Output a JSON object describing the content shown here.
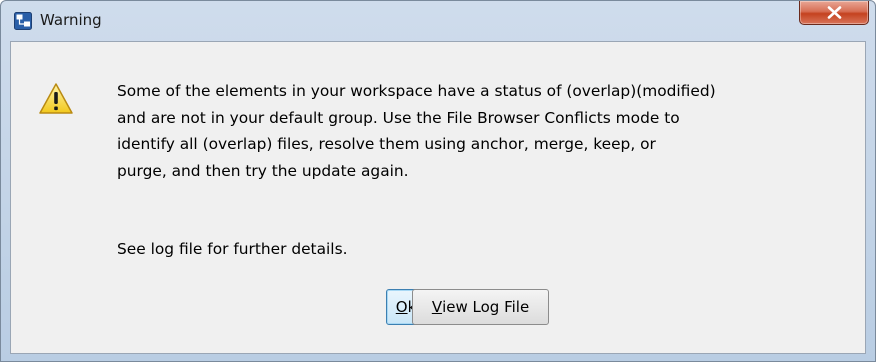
{
  "window": {
    "title": "Warning"
  },
  "message": {
    "lines": [
      "Some of the elements in your workspace have a status of (overlap)(modified)",
      "and are not in your default group. Use the File Browser Conflicts mode to",
      "identify all (overlap) files, resolve them using anchor, merge, keep, or",
      "purge, and then try the update again."
    ],
    "details": "See log file for further details."
  },
  "buttons": {
    "ok_mnemonic": "O",
    "ok_rest": "k",
    "viewlog_mnemonic": "V",
    "viewlog_rest": "iew Log File"
  },
  "icons": {
    "app": "app-window-icon",
    "warning": "warning-triangle-icon",
    "close": "close-icon"
  },
  "colors": {
    "close_button": "#c4421f",
    "warning_yellow": "#f5d94a",
    "content_bg": "#f0f0f0",
    "titlebar": "#b9cde3"
  }
}
